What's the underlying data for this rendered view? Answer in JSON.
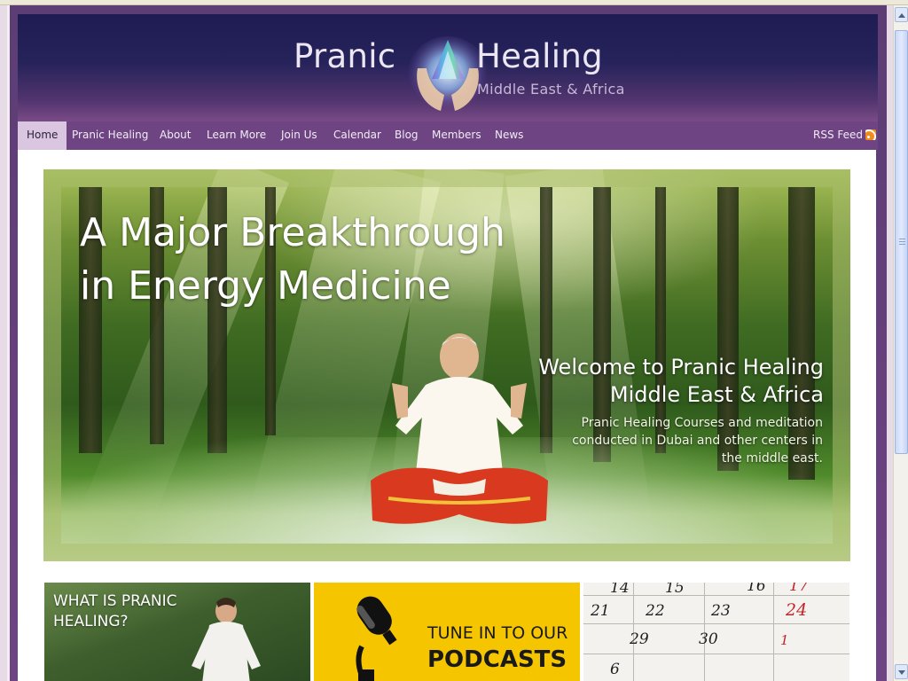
{
  "colors": {
    "header_dark": "#1e1c52",
    "nav_bg": "#6e4483",
    "nav_active_bg": "#dac6e0",
    "podcast_yellow": "#f5c600",
    "calendar_red": "#c0242a",
    "rss_orange": "#f08c1e"
  },
  "header": {
    "logo_left": "Pranic",
    "logo_right": "Healing",
    "logo_sub": "Middle East & Africa"
  },
  "nav": {
    "items": [
      {
        "label": "Home",
        "active": true
      },
      {
        "label": "Pranic Healing"
      },
      {
        "label": "About"
      },
      {
        "label": "Learn More"
      },
      {
        "label": "Join Us"
      },
      {
        "label": "Calendar"
      },
      {
        "label": "Blog"
      },
      {
        "label": "Members"
      },
      {
        "label": "News"
      }
    ],
    "rss_label": "RSS Feed",
    "rss_icon": "rss-icon"
  },
  "hero": {
    "headline_line1": "A Major Breakthrough",
    "headline_line2": "in Energy Medicine",
    "welcome_line1": "Welcome to Pranic Healing",
    "welcome_line2": "Middle East & Africa",
    "description": "Pranic Healing Courses and meditation conducted in Dubai and other centers in the middle east."
  },
  "tiles": [
    {
      "title_line1": "WHAT IS PRANIC",
      "title_line2": "HEALING?"
    },
    {
      "title_line1": "TUNE IN TO OUR",
      "title_line2": "PODCASTS",
      "icon": "microphone-icon"
    },
    {
      "numbers_row1": [
        "14",
        "15",
        "16",
        "17"
      ],
      "numbers_row2": [
        "21",
        "22",
        "23",
        "24"
      ],
      "numbers_row3": [
        "29",
        "30",
        "1"
      ],
      "numbers_row4": [
        "6"
      ]
    }
  ]
}
